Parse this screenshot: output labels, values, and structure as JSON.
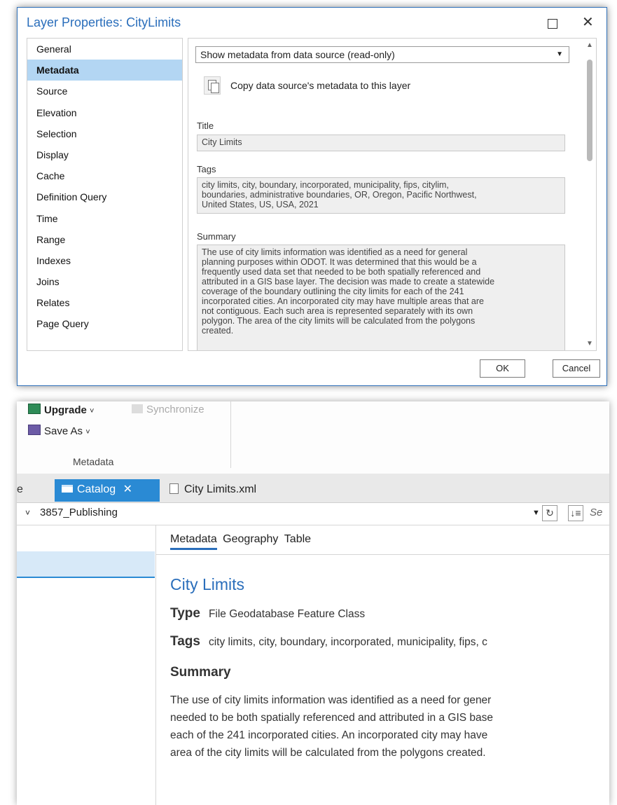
{
  "dialog": {
    "title": "Layer Properties: CityLimits",
    "nav_items": [
      "General",
      "Metadata",
      "Source",
      "Elevation",
      "Selection",
      "Display",
      "Cache",
      "Definition Query",
      "Time",
      "Range",
      "Indexes",
      "Joins",
      "Relates",
      "Page Query"
    ],
    "selected_nav": "Metadata",
    "metadata_mode": "Show metadata from data source (read-only)",
    "copy_label": "Copy data source's metadata to this layer",
    "title_label": "Title",
    "title_value": "City Limits",
    "tags_label": "Tags",
    "tags_value": [
      "city limits, city, boundary, incorporated, municipality, fips, citylim,",
      "boundaries, administrative boundaries, OR, Oregon, Pacific Northwest,",
      "United States, US, USA, 2021"
    ],
    "summary_label": "Summary",
    "summary_value": [
      "The use of city limits information was identified as a need for general",
      "planning purposes within ODOT. It was determined that this would be a",
      "frequently used data set that needed to be both spatially referenced and",
      "attributed in a GIS base layer. The decision was made to create a statewide",
      "coverage of the boundary outlining the city limits for each of the 241",
      "incorporated cities. An incorporated city may have multiple areas that are",
      "not contiguous. Each such area is represented separately with its own",
      "polygon. The area of the city limits will be calculated from the polygons",
      "created."
    ],
    "ok_label": "OK",
    "cancel_label": "Cancel"
  },
  "ribbon": {
    "upgrade_label": "Upgrade",
    "synchronize_label": "Synchronize",
    "save_as_label": "Save As",
    "group_label": "Metadata"
  },
  "tabs": {
    "partial_label": "e",
    "catalog_label": "Catalog",
    "xml_label": "City Limits.xml"
  },
  "path": {
    "value": "3857_Publishing",
    "search_placeholder": "Se"
  },
  "metadata_view": {
    "tabs": [
      "Metadata",
      "Geography",
      "Table"
    ],
    "active_tab": "Metadata",
    "title": "City Limits",
    "type_key": "Type",
    "type_value": "File Geodatabase Feature Class",
    "tags_key": "Tags",
    "tags_value": "city limits, city, boundary, incorporated, municipality, fips, c",
    "summary_heading": "Summary",
    "summary_lines": [
      "The use of city limits information was identified as a need for gener",
      "needed to be both spatially referenced and attributed in a GIS base",
      "each of the 241 incorporated cities. An incorporated city may have",
      "area of the city limits will be calculated from the polygons created."
    ]
  },
  "colors": {
    "accent": "#2a6ebb",
    "nav_selected": "#b3d6f3",
    "tab_active": "#2a8ad4"
  }
}
